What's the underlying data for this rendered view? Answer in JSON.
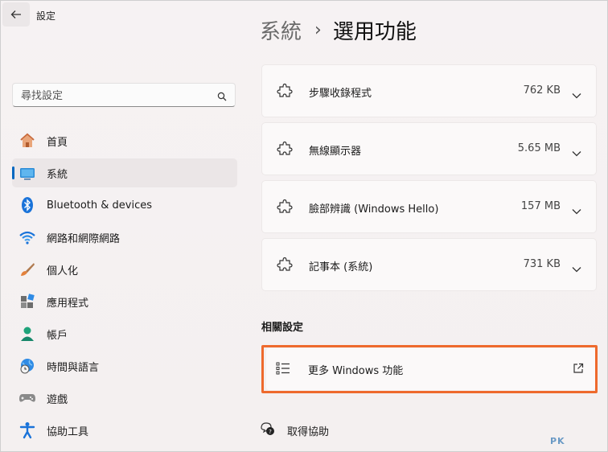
{
  "app": {
    "title": "設定"
  },
  "search": {
    "placeholder": "尋找設定"
  },
  "nav": {
    "items": [
      {
        "label": "首頁",
        "icon": "home-icon"
      },
      {
        "label": "系統",
        "icon": "system-icon",
        "active": true
      },
      {
        "label": "Bluetooth & devices",
        "icon": "bluetooth-icon"
      },
      {
        "label": "網路和網際網路",
        "icon": "wifi-icon"
      },
      {
        "label": "個人化",
        "icon": "brush-icon"
      },
      {
        "label": "應用程式",
        "icon": "apps-icon"
      },
      {
        "label": "帳戶",
        "icon": "account-icon"
      },
      {
        "label": "時間與語言",
        "icon": "time-language-icon"
      },
      {
        "label": "遊戲",
        "icon": "gamepad-icon"
      },
      {
        "label": "協助工具",
        "icon": "accessibility-icon"
      }
    ]
  },
  "header": {
    "parent": "系統",
    "separator": "›",
    "current": "選用功能"
  },
  "features": [
    {
      "name": "步驟收錄程式",
      "size": "762 KB"
    },
    {
      "name": "無線顯示器",
      "size": "5.65 MB"
    },
    {
      "name": "臉部辨識 (Windows Hello)",
      "size": "157 MB"
    },
    {
      "name": "記事本 (系統)",
      "size": "731 KB"
    }
  ],
  "related": {
    "title": "相關設定",
    "more_windows_features": "更多 Windows 功能"
  },
  "help": {
    "label": "取得協助"
  },
  "watermark": {
    "text": "PK"
  },
  "colors": {
    "accent": "#0067c0",
    "highlight": "#ee6a2d"
  }
}
